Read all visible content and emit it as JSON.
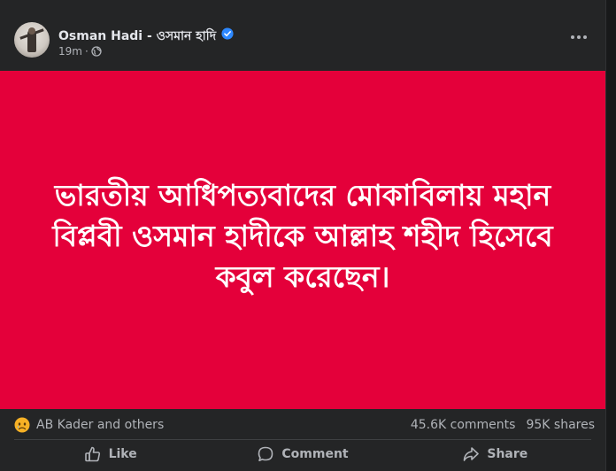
{
  "post": {
    "author": "Osman Hadi - ওসমান হাদি",
    "time": "19m",
    "separator": "·",
    "image_text": "ভারতীয় আধিপত্যবাদের মোকাবিলায় মহান বিপ্লবী ওসমান হাদীকে আল্লাহ শহীদ হিসেবে কবুল করেছেন।",
    "reactors": "AB Kader and others",
    "comments": "45.6K comments",
    "shares": "95K shares",
    "actions": {
      "like": "Like",
      "comment": "Comment",
      "share": "Share"
    },
    "icons": {
      "verified": "verified-badge-icon",
      "privacy": "globe-icon",
      "reaction": "sad-emoji-icon",
      "more": "more-options-icon"
    },
    "colors": {
      "image_background": "#e4003a",
      "verified": "#2d88ff",
      "card_background": "#242526"
    }
  }
}
